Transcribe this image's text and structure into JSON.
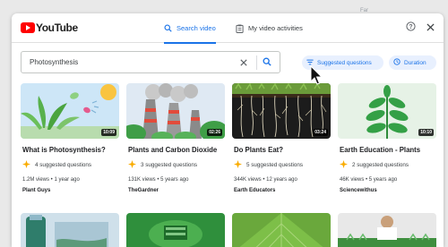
{
  "background_text": "Far",
  "header": {
    "logo_text": "YouTube",
    "tabs": [
      {
        "label": "Search video",
        "active": true,
        "icon": "search-icon"
      },
      {
        "label": "My video activities",
        "active": false,
        "icon": "clipboard-icon"
      }
    ],
    "help_icon": "help-icon",
    "close_icon": "close-icon"
  },
  "search": {
    "value": "Photosynthesis",
    "clear_icon": "close-icon",
    "search_icon": "search-icon"
  },
  "filters": {
    "suggested_label": "Suggested questions",
    "duration_label": "Duration"
  },
  "colors": {
    "accent": "#1a73e8",
    "chip_bg": "#e8f0fe",
    "star": "#f9ab00",
    "brand": "#ff0000"
  },
  "videos": [
    {
      "title": "What is Photosynthesis?",
      "duration": "10:09",
      "suggested": "4 suggested questions",
      "views": "1.2M views",
      "age": "1 year ago",
      "channel": "Plant Guys"
    },
    {
      "title": "Plants and Carbon Dioxide",
      "duration": "02:26",
      "suggested": "3 suggested questions",
      "views": "131K views",
      "age": "5 years ago",
      "channel": "TheGardner"
    },
    {
      "title": "Do Plants Eat?",
      "duration": "03:24",
      "suggested": "5 suggested questions",
      "views": "344K views",
      "age": "12 years ago",
      "channel": "Earth Educators"
    },
    {
      "title": "Earth Education - Plants",
      "duration": "10:10",
      "suggested": "2 suggested questions",
      "views": "46K views",
      "age": "5 years ago",
      "channel": "Sciencewithus"
    }
  ]
}
